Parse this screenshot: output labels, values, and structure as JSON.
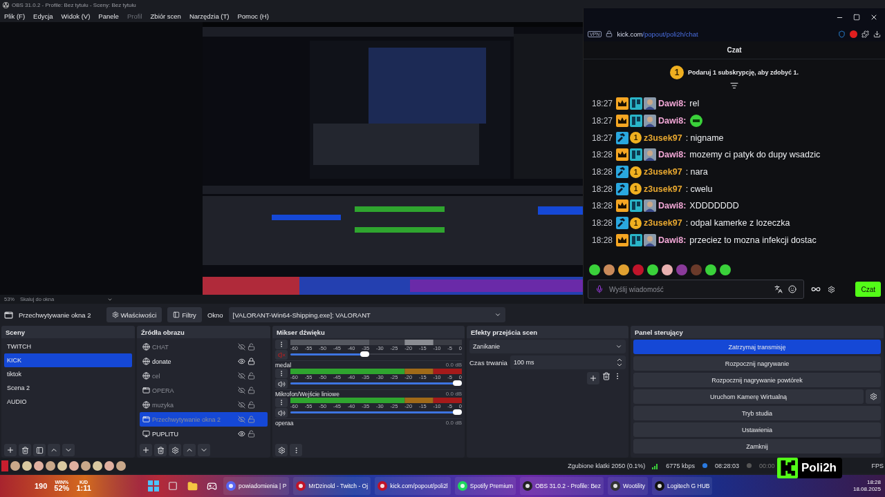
{
  "window": {
    "title": "OBS 31.0.2 - Profile: Bez tytułu - Sceny: Bez tytułu"
  },
  "menu": [
    {
      "label": "Plik (F)",
      "disabled": false
    },
    {
      "label": "Edycja",
      "disabled": false
    },
    {
      "label": "Widok (V)",
      "disabled": false
    },
    {
      "label": "Panele",
      "disabled": false
    },
    {
      "label": "Profil",
      "disabled": true
    },
    {
      "label": "Zbiór scen",
      "disabled": false
    },
    {
      "label": "Narzędzia (T)",
      "disabled": false
    },
    {
      "label": "Pomoc (H)",
      "disabled": false
    }
  ],
  "preview": {
    "kind": "picture",
    "zoom": "53%",
    "scale_mode": "Skaluj do okna"
  },
  "source_toolbar": {
    "source": "Przechwytywanie okna 2",
    "buttons": [
      {
        "kind": "properties",
        "label": "Właściwości"
      },
      {
        "kind": "filters",
        "label": "Filtry"
      }
    ],
    "window_label": "Okno",
    "window_value": "[VALORANT-Win64-Shipping.exe]: VALORANT"
  },
  "scenes": {
    "title": "Sceny",
    "items": [
      {
        "label": "TWITCH",
        "selected": false
      },
      {
        "label": "KICK",
        "selected": true
      },
      {
        "label": "tiktok",
        "selected": false
      },
      {
        "label": "Scena 2",
        "selected": false
      },
      {
        "label": "AUDIO",
        "selected": false
      }
    ]
  },
  "sources": {
    "title": "Źródła obrazu",
    "items": [
      {
        "label": "CHAT",
        "kind": "browser",
        "visible": false,
        "locked": false,
        "selected": false
      },
      {
        "label": "donate",
        "kind": "browser",
        "visible": true,
        "locked": true,
        "selected": false
      },
      {
        "label": "cel",
        "kind": "browser",
        "visible": false,
        "locked": false,
        "selected": false
      },
      {
        "label": "OPERA",
        "kind": "window",
        "visible": false,
        "locked": false,
        "selected": false
      },
      {
        "label": "muzyka",
        "kind": "browser",
        "visible": false,
        "locked": false,
        "selected": false
      },
      {
        "label": "Przechwytywanie okna 2",
        "kind": "window",
        "visible": false,
        "locked": false,
        "selected": true
      },
      {
        "label": "PUPLITU",
        "kind": "display",
        "visible": true,
        "locked": false,
        "selected": false
      }
    ]
  },
  "mixer": {
    "title": "Mikser dźwięku",
    "channels": [
      {
        "kind": "full",
        "muted": true,
        "level": 0.46,
        "ticks": [
          "-60",
          "-55",
          "-50",
          "-45",
          "-40",
          "-35",
          "-30",
          "-25",
          "-20",
          "-15",
          "-10",
          "-5",
          "0"
        ]
      },
      {
        "kind": "full",
        "name": "medal",
        "db": "0.0 dB",
        "muted": false,
        "level": 1,
        "ticks": [
          "-60",
          "-55",
          "-50",
          "-45",
          "-40",
          "-35",
          "-30",
          "-25",
          "-20",
          "-15",
          "-10",
          "-5",
          "0"
        ]
      },
      {
        "kind": "full",
        "name": "Mikrofon/Wejście liniowe",
        "db": "0.0 dB",
        "muted": false,
        "level": 1,
        "ticks": [
          "-60",
          "-55",
          "-50",
          "-45",
          "-40",
          "-35",
          "-30",
          "-25",
          "-20",
          "-15",
          "-10",
          "-5",
          "0"
        ]
      },
      {
        "kind": "cut",
        "name": "operaa",
        "db": "0.0 dB"
      }
    ]
  },
  "transitions": {
    "title": "Efekty przejścia scen",
    "transition": "Zanikanie",
    "duration_label": "Czas trwania",
    "duration": "100 ms"
  },
  "controls": {
    "title": "Panel sterujący",
    "buttons": [
      {
        "label": "Zatrzymaj transmisję",
        "active": true,
        "settings": false
      },
      {
        "label": "Rozpocznij nagrywanie",
        "active": false,
        "settings": false
      },
      {
        "label": "Rozpocznij nagrywanie powtórek",
        "active": false,
        "settings": false
      },
      {
        "label": "Uruchom Kamerę Wirtualną",
        "active": false,
        "settings": true
      },
      {
        "label": "Tryb studia",
        "active": false,
        "settings": false
      },
      {
        "label": "Ustawienia",
        "active": false,
        "settings": false
      },
      {
        "label": "Zamknij",
        "active": false,
        "settings": false
      }
    ]
  },
  "status_bar": {
    "dropped": "Zgubione klatki 2050 (0.1%)",
    "bitrate": "6775 kbps",
    "stream_time": "08:28:03",
    "record_time": "00:00",
    "fps": "FPS"
  },
  "logo": {
    "name": "Poli2h"
  },
  "chat": {
    "vpn": "VPN",
    "url_host": "kick.com",
    "url_path": "/popout/poli2h/chat",
    "title": "Czat",
    "gift": {
      "badge": "1",
      "text": "Podaruj 1 subskrypcję, aby zdobyć 1."
    },
    "messages": [
      {
        "time": "18:27",
        "badges": [
          {
            "kind": "crown"
          },
          {
            "kind": "pixel"
          },
          {
            "kind": "avatar"
          }
        ],
        "user": "Dawi8:",
        "color": "#f2a7d6",
        "kind": "text",
        "text": "rel"
      },
      {
        "time": "18:27",
        "badges": [
          {
            "kind": "crown"
          },
          {
            "kind": "pixel"
          },
          {
            "kind": "avatar"
          }
        ],
        "user": "Dawi8:",
        "color": "#f2a7d6",
        "kind": "emote"
      },
      {
        "time": "18:27",
        "badges": [
          {
            "kind": "hammer"
          },
          {
            "kind": "coin",
            "label": "1"
          }
        ],
        "user": "z3usek97",
        "color": "#e8a830",
        "kind": "text",
        "text": ": nigname"
      },
      {
        "time": "18:28",
        "badges": [
          {
            "kind": "crown"
          },
          {
            "kind": "pixel"
          },
          {
            "kind": "avatar"
          }
        ],
        "user": "Dawi8:",
        "color": "#f2a7d6",
        "kind": "text",
        "text": "mozemy ci patyk do dupy wsadzic"
      },
      {
        "time": "18:28",
        "badges": [
          {
            "kind": "hammer"
          },
          {
            "kind": "coin",
            "label": "1"
          }
        ],
        "user": "z3usek97",
        "color": "#e8a830",
        "kind": "text",
        "text": ": nara"
      },
      {
        "time": "18:28",
        "badges": [
          {
            "kind": "hammer"
          },
          {
            "kind": "coin",
            "label": "1"
          }
        ],
        "user": "z3usek97",
        "color": "#e8a830",
        "kind": "text",
        "text": ": cwelu"
      },
      {
        "time": "18:28",
        "badges": [
          {
            "kind": "crown"
          },
          {
            "kind": "pixel"
          },
          {
            "kind": "avatar"
          }
        ],
        "user": "Dawi8:",
        "color": "#f2a7d6",
        "kind": "text",
        "text": "XDDDDDDD"
      },
      {
        "time": "18:28",
        "badges": [
          {
            "kind": "hammer"
          },
          {
            "kind": "coin",
            "label": "1"
          }
        ],
        "user": "z3usek97",
        "color": "#e8a830",
        "kind": "text",
        "text": ": odpal kamerke z lozeczka"
      },
      {
        "time": "18:28",
        "badges": [
          {
            "kind": "crown"
          },
          {
            "kind": "pixel"
          },
          {
            "kind": "avatar"
          }
        ],
        "user": "Dawi8:",
        "color": "#f2a7d6",
        "kind": "text",
        "text": "przeciez to mozna infekcji dostac"
      }
    ],
    "input": {
      "placeholder": "Wyślij wiadomość"
    },
    "send": "Czat"
  },
  "taskbar": {
    "widget": {
      "rank": "190",
      "winrate_label": "WIN%",
      "winrate": "52%",
      "kd_label": "K/D",
      "kd": "1:11"
    },
    "apps": [
      {
        "kind": "discord",
        "label": "powiadomienia | P"
      },
      {
        "kind": "opera",
        "label": "MrDzinold - Twitch - Oj"
      },
      {
        "kind": "opera",
        "label": "kick.com/popout/poli2l"
      },
      {
        "kind": "spotify",
        "label": "Spotify Premium"
      },
      {
        "kind": "obs",
        "label": "OBS 31.0.2 - Profile: Bez"
      },
      {
        "kind": "wooting",
        "label": "Wootility"
      },
      {
        "kind": "logitech",
        "label": "Logitech G HUB"
      }
    ],
    "time": "18:28",
    "date": "18.08.2025"
  }
}
